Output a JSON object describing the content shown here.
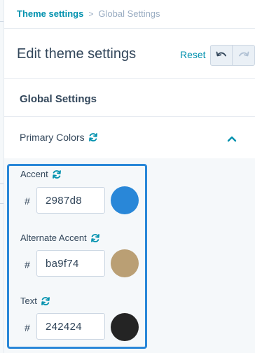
{
  "breadcrumb": {
    "parent": "Theme settings",
    "separator": ">",
    "current": "Global Settings"
  },
  "header": {
    "title": "Edit theme settings",
    "reset_label": "Reset",
    "undo_icon": "undo-icon",
    "redo_icon": "redo-icon"
  },
  "section": {
    "title": "Global Settings"
  },
  "group": {
    "title": "Primary Colors",
    "icon": "sync-icon",
    "state_icon": "chevron-up-icon"
  },
  "colors": [
    {
      "label": "Accent",
      "prefix": "#",
      "value": "2987d8",
      "swatch": "#2987d8"
    },
    {
      "label": "Alternate Accent",
      "prefix": "#",
      "value": "ba9f74",
      "swatch": "#ba9f74"
    },
    {
      "label": "Text",
      "prefix": "#",
      "value": "242424",
      "swatch": "#242424"
    }
  ],
  "theme": {
    "link": "#0091ae",
    "focus": "#2987d8",
    "text": "#33475b"
  }
}
